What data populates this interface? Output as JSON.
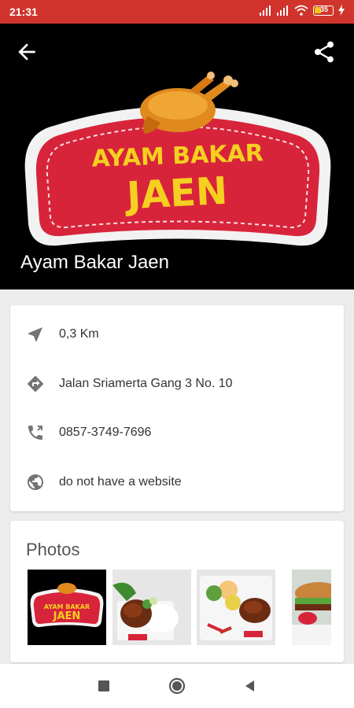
{
  "status_bar": {
    "time": "21:31",
    "battery_level": "35",
    "icons": [
      "signal-icon",
      "signal-icon",
      "wifi-icon",
      "battery-icon",
      "charging-icon"
    ]
  },
  "header": {
    "back_icon": "arrow-back-icon",
    "share_icon": "share-icon",
    "logo": {
      "line1": "AYAM BAKAR",
      "line2": "JAEN"
    },
    "title": "Ayam Bakar Jaen"
  },
  "info": {
    "distance": "0,3 Km",
    "address": "Jalan Sriamerta Gang 3 No. 10",
    "phone": "0857-3749-7696",
    "website": "do not have a website"
  },
  "photos": {
    "title": "Photos",
    "thumb_logo": {
      "line1": "AYAM BAKAR",
      "line2": "JAEN"
    }
  },
  "colors": {
    "status_bar": "#d0342c",
    "logo_red": "#d8243a",
    "logo_yellow": "#f5d020"
  }
}
